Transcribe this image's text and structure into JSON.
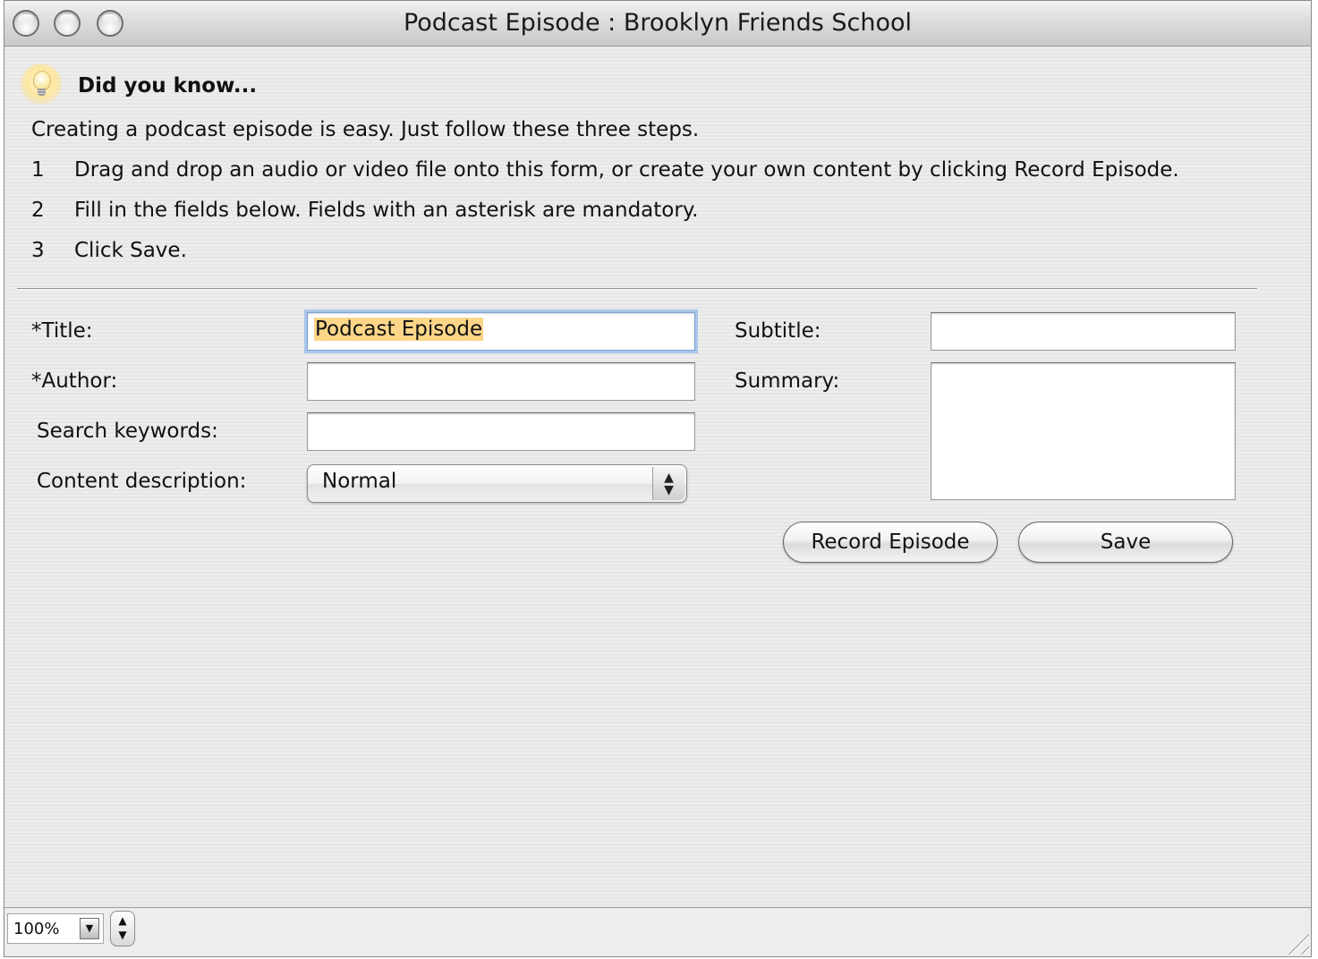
{
  "window": {
    "title": "Podcast Episode : Brooklyn Friends School"
  },
  "hint": {
    "icon": "lightbulb-icon",
    "heading": "Did you know...",
    "intro": "Creating a podcast episode is easy. Just follow these three steps.",
    "steps": [
      {
        "num": "1",
        "text": "Drag and drop an audio or video file onto this form, or create your own content by clicking Record Episode."
      },
      {
        "num": "2",
        "text": "Fill in the fields below. Fields with an asterisk are mandatory."
      },
      {
        "num": "3",
        "text": "Click Save."
      }
    ]
  },
  "form": {
    "title_label": "*Title:",
    "title_value": "Podcast Episode",
    "author_label": "*Author:",
    "author_value": "",
    "keywords_label": "Search keywords:",
    "keywords_value": "",
    "content_label": "Content description:",
    "content_value": "Normal",
    "subtitle_label": "Subtitle:",
    "subtitle_value": "",
    "summary_label": "Summary:",
    "summary_value": ""
  },
  "buttons": {
    "record": "Record Episode",
    "save": "Save"
  },
  "statusbar": {
    "zoom": "100%"
  }
}
